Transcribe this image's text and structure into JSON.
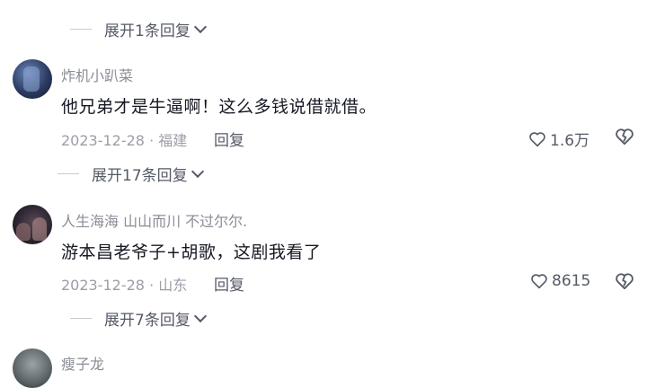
{
  "colors": {
    "text": "#161823",
    "muted": "#8a8d96",
    "meta": "#9b9ea6",
    "icon": "#555a66"
  },
  "top_comment": {
    "expand_label": "展开1条回复"
  },
  "comments": [
    {
      "username": "炸机小趴菜",
      "text": "他兄弟才是牛逼啊！这么多钱说借就借。",
      "date_location": "2023-12-28 · 福建",
      "reply_label": "回复",
      "likes": "1.6万",
      "expand_label": "展开17条回复"
    },
    {
      "username": "人生海海 山山而川 不过尔尔.",
      "text": "游本昌老爷子+胡歌，这剧我看了",
      "date_location": "2023-12-28 · 山东",
      "reply_label": "回复",
      "likes": "8615",
      "expand_label": "展开7条回复"
    },
    {
      "username": "瘦子龙"
    }
  ],
  "icons": [
    "heart-icon",
    "dislike-heart-icon",
    "chevron-down-icon"
  ]
}
